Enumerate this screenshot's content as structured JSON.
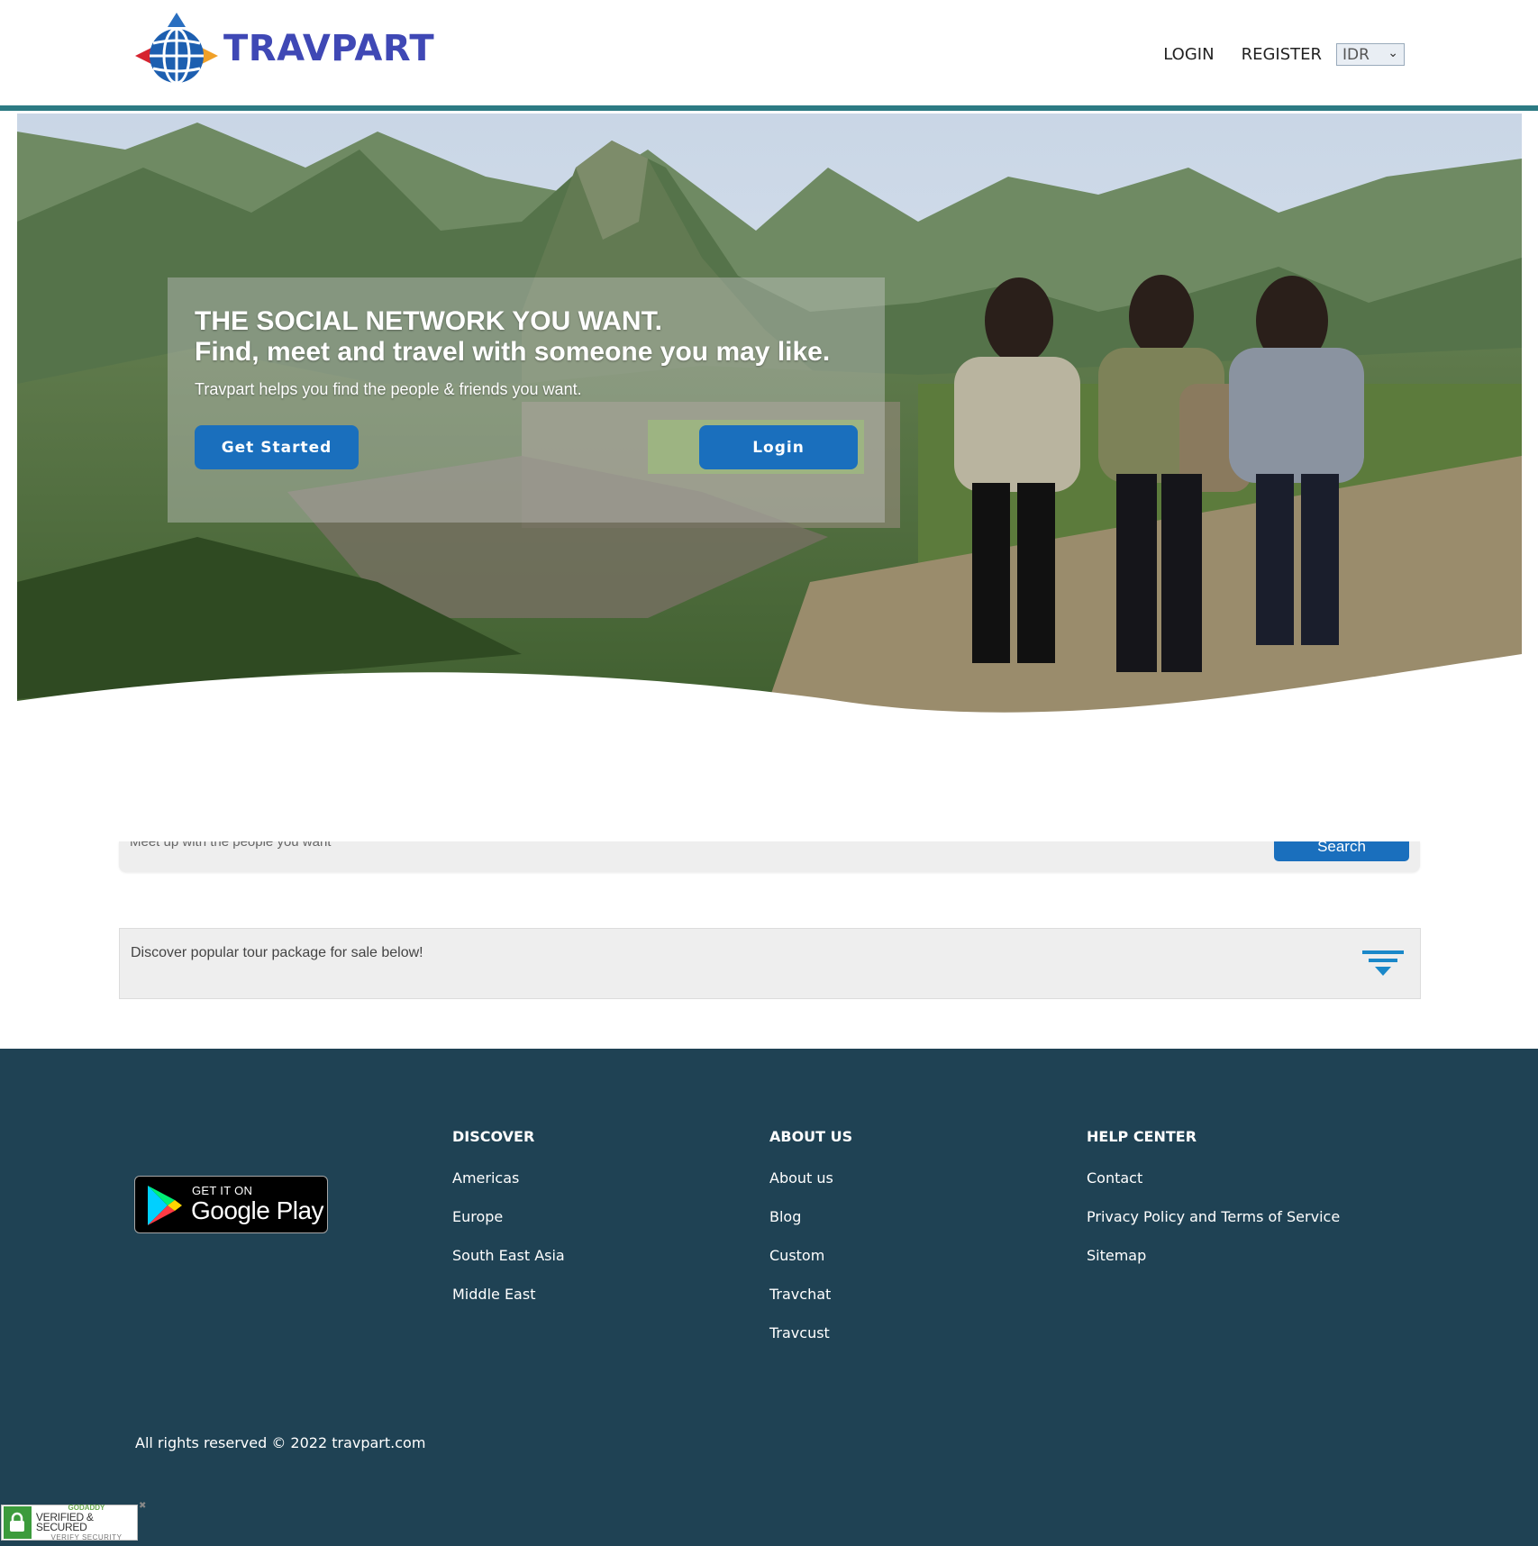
{
  "brand": {
    "name": "TRAVPART"
  },
  "nav": {
    "login": "LOGIN",
    "register": "REGISTER",
    "currency": "IDR"
  },
  "hero": {
    "title": "THE SOCIAL NETWORK YOU WANT.",
    "subtitle": "Find, meet and travel with someone you may like.",
    "description": "Travpart helps you find the people & friends you want.",
    "get_started": "Get Started",
    "login": "Login"
  },
  "search": {
    "placeholder": "Meet up with the people you want",
    "button": "Search"
  },
  "discover": {
    "text": "Discover popular tour package for sale below!",
    "icon": "filter-icon"
  },
  "footer": {
    "badge": {
      "small": "GET IT ON",
      "big": "Google Play"
    },
    "columns": [
      {
        "heading": "DISCOVER",
        "items": [
          "Americas",
          "Europe",
          "South East Asia",
          "Middle East"
        ]
      },
      {
        "heading": "ABOUT US",
        "items": [
          "About us",
          "Blog",
          "Custom",
          "Travchat",
          "Travcust"
        ]
      },
      {
        "heading": "HELP CENTER",
        "items": [
          "Contact",
          "Privacy Policy and Terms of Service",
          "Sitemap"
        ]
      }
    ],
    "copyright": "All rights reserved © 2022 travpart.com",
    "ssl": {
      "top": "GODADDY",
      "mid": "VERIFIED & SECURED",
      "bot": "VERIFY SECURITY"
    }
  },
  "colors": {
    "brand": "#3f48b5",
    "accent_line": "#2c7b83",
    "button": "#1a6fbd",
    "footer_bg": "#1f4254"
  }
}
